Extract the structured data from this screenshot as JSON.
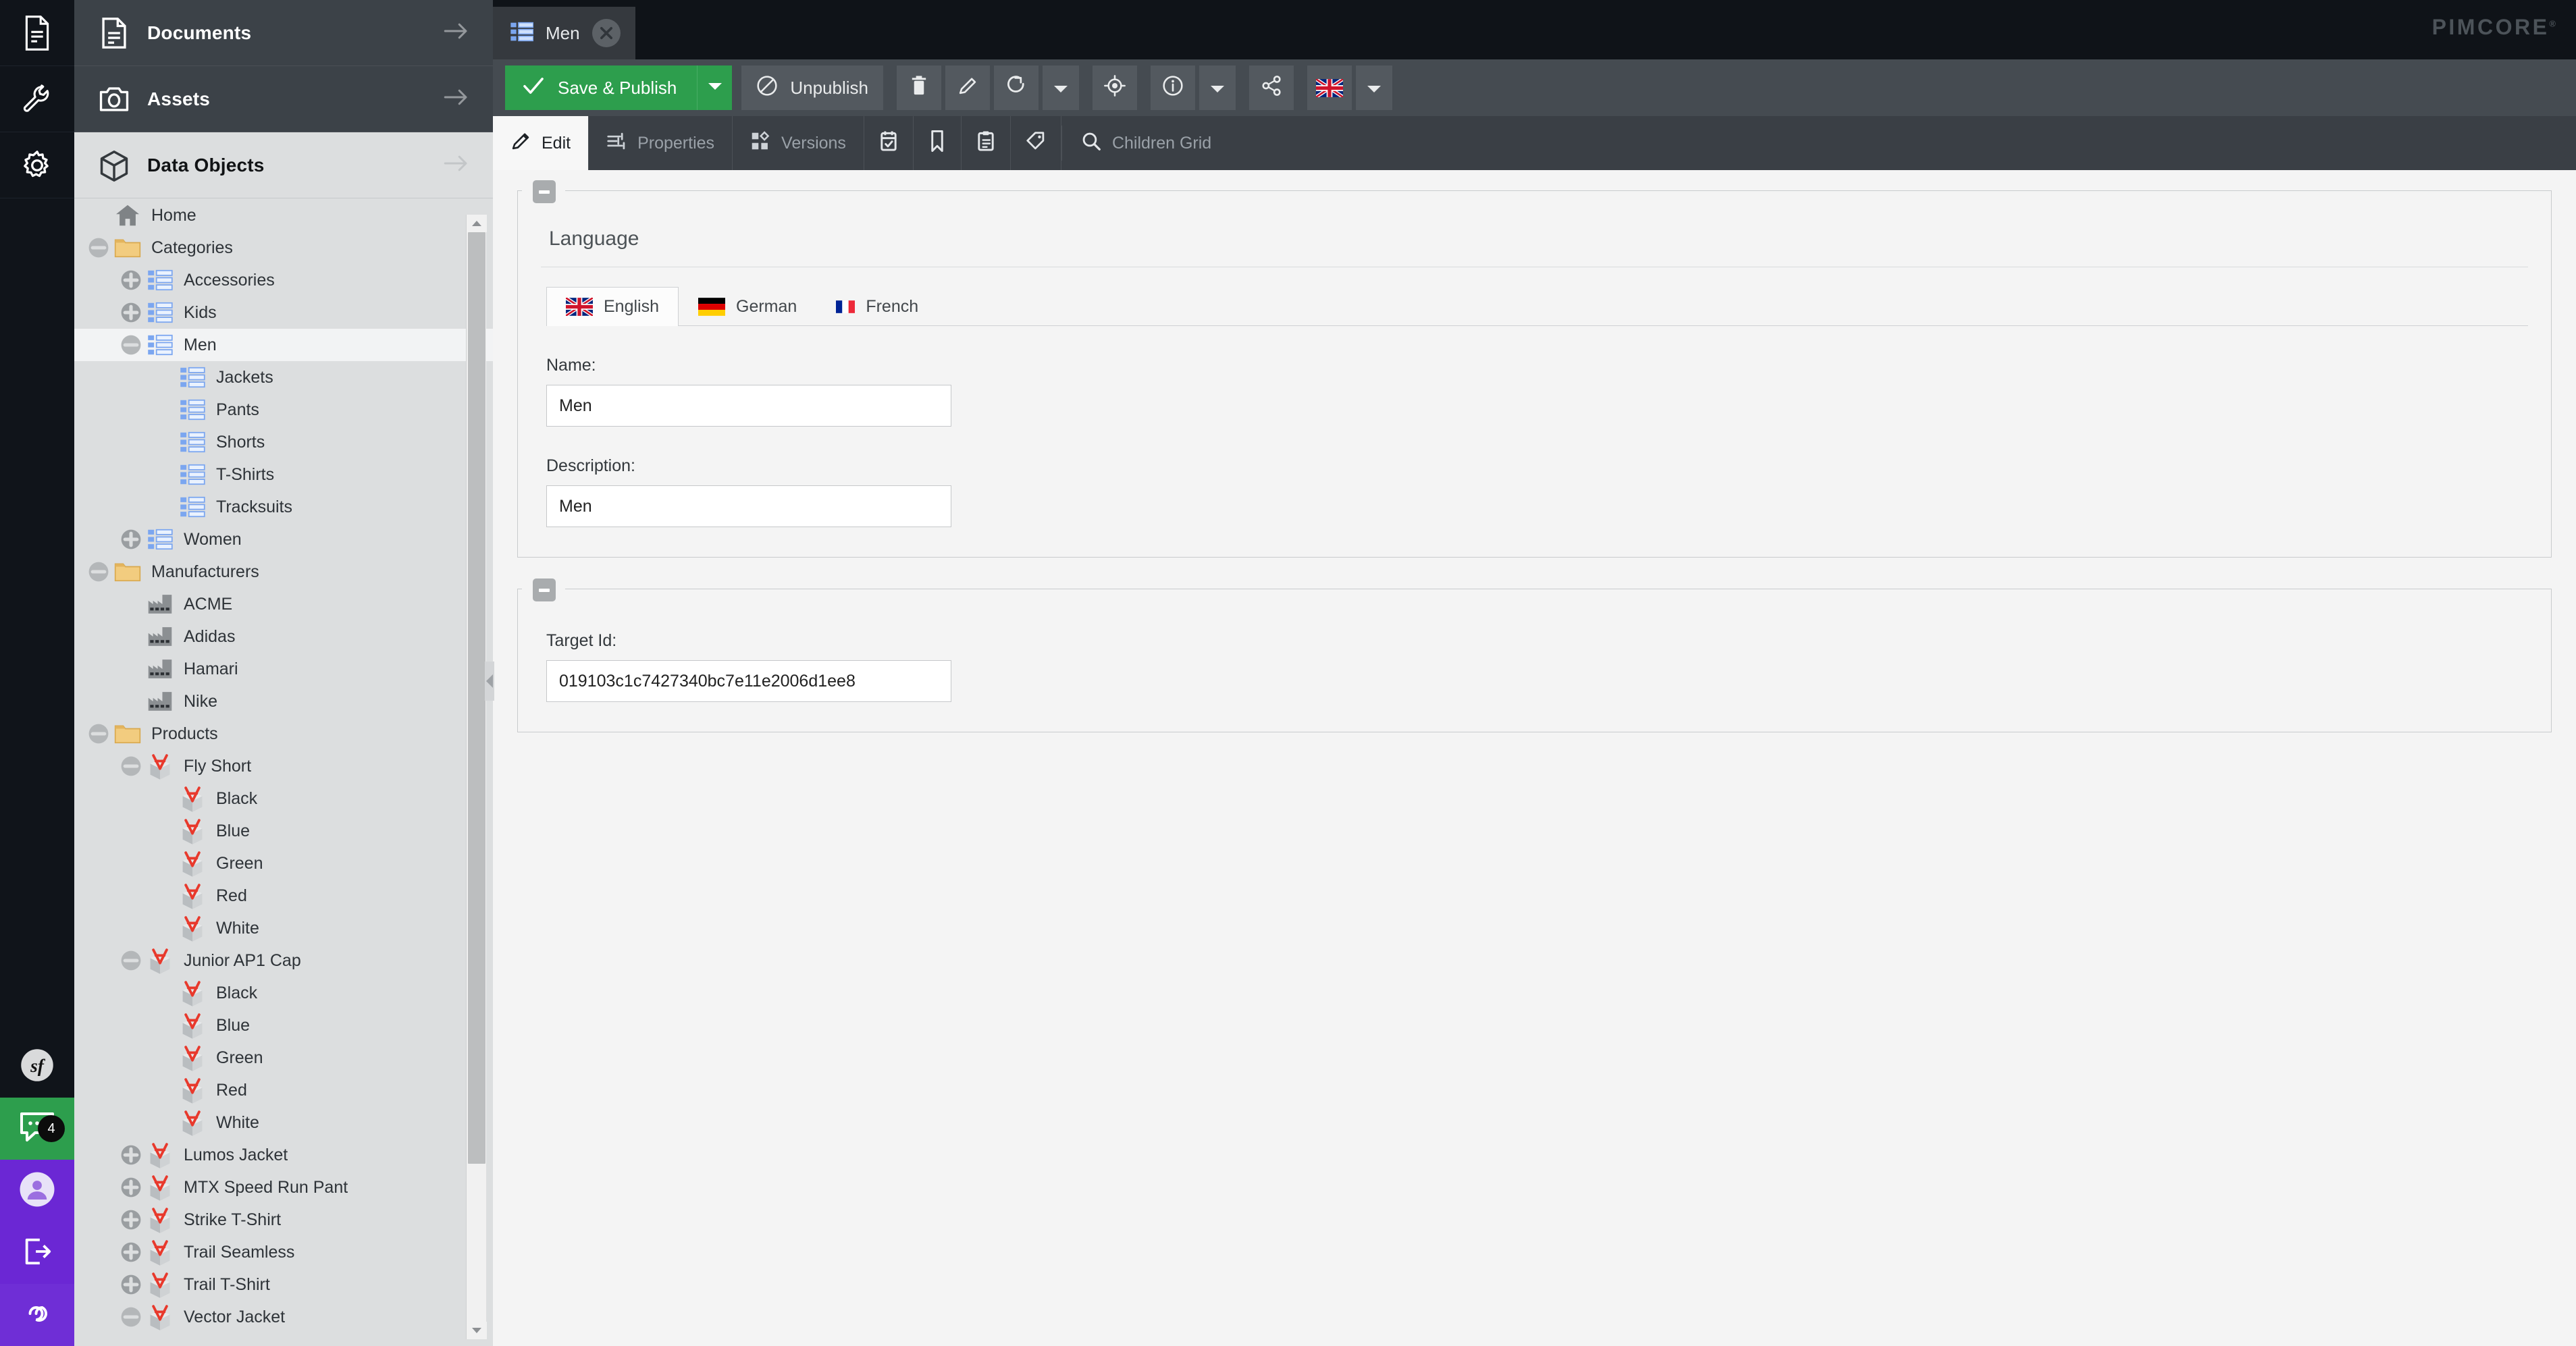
{
  "app": {
    "brand": "PIMCORE",
    "brand_sup": "®"
  },
  "rail": {
    "items": [
      {
        "name": "documents-rail-icon",
        "icon": "file-icon"
      },
      {
        "name": "tools-rail-icon",
        "icon": "wrench-icon"
      },
      {
        "name": "settings-rail-icon",
        "icon": "gear-icon"
      }
    ],
    "bottom": [
      {
        "name": "symfony-profiler",
        "icon": "symfony-icon",
        "label": ""
      },
      {
        "name": "notifications",
        "icon": "chat-icon",
        "badge": "4"
      },
      {
        "name": "user-profile",
        "icon": "user-avatar-icon"
      },
      {
        "name": "logout",
        "icon": "logout-icon"
      },
      {
        "name": "pimcore-infinity",
        "icon": "infinity-icon"
      }
    ]
  },
  "nav": {
    "sections": [
      {
        "label": "Documents",
        "icon": "document-icon",
        "active": false
      },
      {
        "label": "Assets",
        "icon": "camera-icon",
        "active": false
      },
      {
        "label": "Data Objects",
        "icon": "cube-icon",
        "active": true
      }
    ]
  },
  "tree": {
    "nodes": [
      {
        "label": "Home",
        "depth": 0,
        "toggle": "none",
        "icon": "home-icon",
        "selected": false
      },
      {
        "label": "Categories",
        "depth": 0,
        "toggle": "collapse",
        "icon": "folder-icon",
        "selected": false
      },
      {
        "label": "Accessories",
        "depth": 1,
        "toggle": "expand",
        "icon": "list-icon",
        "selected": false
      },
      {
        "label": "Kids",
        "depth": 1,
        "toggle": "expand",
        "icon": "list-icon",
        "selected": false
      },
      {
        "label": "Men",
        "depth": 1,
        "toggle": "collapse",
        "icon": "list-icon",
        "selected": true
      },
      {
        "label": "Jackets",
        "depth": 2,
        "toggle": "none",
        "icon": "list-icon",
        "selected": false
      },
      {
        "label": "Pants",
        "depth": 2,
        "toggle": "none",
        "icon": "list-icon",
        "selected": false
      },
      {
        "label": "Shorts",
        "depth": 2,
        "toggle": "none",
        "icon": "list-icon",
        "selected": false
      },
      {
        "label": "T-Shirts",
        "depth": 2,
        "toggle": "none",
        "icon": "list-icon",
        "selected": false
      },
      {
        "label": "Tracksuits",
        "depth": 2,
        "toggle": "none",
        "icon": "list-icon",
        "selected": false
      },
      {
        "label": "Women",
        "depth": 1,
        "toggle": "expand",
        "icon": "list-icon",
        "selected": false
      },
      {
        "label": "Manufacturers",
        "depth": 0,
        "toggle": "collapse",
        "icon": "folder-icon",
        "selected": false
      },
      {
        "label": "ACME",
        "depth": 1,
        "toggle": "none",
        "icon": "factory-icon",
        "selected": false
      },
      {
        "label": "Adidas",
        "depth": 1,
        "toggle": "none",
        "icon": "factory-icon",
        "selected": false
      },
      {
        "label": "Hamari",
        "depth": 1,
        "toggle": "none",
        "icon": "factory-icon",
        "selected": false
      },
      {
        "label": "Nike",
        "depth": 1,
        "toggle": "none",
        "icon": "factory-icon",
        "selected": false
      },
      {
        "label": "Products",
        "depth": 0,
        "toggle": "collapse",
        "icon": "folder-icon",
        "selected": false
      },
      {
        "label": "Fly Short",
        "depth": 1,
        "toggle": "collapse",
        "icon": "product-icon",
        "selected": false
      },
      {
        "label": "Black",
        "depth": 2,
        "toggle": "none",
        "icon": "product-icon",
        "selected": false
      },
      {
        "label": "Blue",
        "depth": 2,
        "toggle": "none",
        "icon": "product-icon",
        "selected": false
      },
      {
        "label": "Green",
        "depth": 2,
        "toggle": "none",
        "icon": "product-icon",
        "selected": false
      },
      {
        "label": "Red",
        "depth": 2,
        "toggle": "none",
        "icon": "product-icon",
        "selected": false
      },
      {
        "label": "White",
        "depth": 2,
        "toggle": "none",
        "icon": "product-icon",
        "selected": false
      },
      {
        "label": "Junior AP1 Cap",
        "depth": 1,
        "toggle": "collapse",
        "icon": "product-icon",
        "selected": false
      },
      {
        "label": "Black",
        "depth": 2,
        "toggle": "none",
        "icon": "product-icon",
        "selected": false
      },
      {
        "label": "Blue",
        "depth": 2,
        "toggle": "none",
        "icon": "product-icon",
        "selected": false
      },
      {
        "label": "Green",
        "depth": 2,
        "toggle": "none",
        "icon": "product-icon",
        "selected": false
      },
      {
        "label": "Red",
        "depth": 2,
        "toggle": "none",
        "icon": "product-icon",
        "selected": false
      },
      {
        "label": "White",
        "depth": 2,
        "toggle": "none",
        "icon": "product-icon",
        "selected": false
      },
      {
        "label": "Lumos Jacket",
        "depth": 1,
        "toggle": "expand",
        "icon": "product-icon",
        "selected": false
      },
      {
        "label": "MTX Speed Run Pant",
        "depth": 1,
        "toggle": "expand",
        "icon": "product-icon",
        "selected": false
      },
      {
        "label": "Strike T-Shirt",
        "depth": 1,
        "toggle": "expand",
        "icon": "product-icon",
        "selected": false
      },
      {
        "label": "Trail Seamless",
        "depth": 1,
        "toggle": "expand",
        "icon": "product-icon",
        "selected": false
      },
      {
        "label": "Trail T-Shirt",
        "depth": 1,
        "toggle": "expand",
        "icon": "product-icon",
        "selected": false
      },
      {
        "label": "Vector Jacket",
        "depth": 1,
        "toggle": "collapse",
        "icon": "product-icon",
        "selected": false
      }
    ]
  },
  "doc_tab": {
    "label": "Men",
    "icon": "list-icon",
    "close_icon": "close-icon"
  },
  "toolbar": {
    "save_publish_label": "Save & Publish",
    "save_publish_icon": "check-icon",
    "save_publish_menu_icon": "caret-down-icon",
    "unpublish_label": "Unpublish",
    "unpublish_icon": "no-entry-icon",
    "delete_icon": "trash-icon",
    "rename_icon": "pencil-icon",
    "reload_icon": "refresh-icon",
    "reload_menu_icon": "caret-down-icon",
    "locate_icon": "crosshair-icon",
    "info_icon": "info-icon",
    "info_menu_icon": "caret-down-icon",
    "share_icon": "share-icon",
    "language_icon": "flag-uk-icon",
    "language_menu_icon": "caret-down-icon"
  },
  "subtabs": {
    "items": [
      {
        "label": "Edit",
        "icon": "pencil-icon",
        "active": true
      },
      {
        "label": "Properties",
        "icon": "sliders-icon",
        "active": false
      },
      {
        "label": "Versions",
        "icon": "versions-icon",
        "active": false
      },
      {
        "label": "",
        "icon": "schedule-icon",
        "active": false
      },
      {
        "label": "",
        "icon": "bookmark-icon",
        "active": false
      },
      {
        "label": "",
        "icon": "notes-icon",
        "active": false
      },
      {
        "label": "",
        "icon": "tag-icon",
        "active": false
      }
    ],
    "search": {
      "label": "Children Grid",
      "icon": "search-icon"
    }
  },
  "editor": {
    "language_fieldset": {
      "legend": "Language",
      "collapse_icon": "minus-icon",
      "language_tabs": [
        {
          "label": "English",
          "flag": "flag-uk-icon",
          "active": true
        },
        {
          "label": "German",
          "flag": "flag-de-icon",
          "active": false
        },
        {
          "label": "French",
          "flag": "flag-fr-icon",
          "active": false
        }
      ],
      "fields": [
        {
          "label": "Name:",
          "value": "Men",
          "placeholder": ""
        },
        {
          "label": "Description:",
          "value": "Men",
          "placeholder": ""
        }
      ]
    },
    "target_fieldset": {
      "collapse_icon": "minus-icon",
      "fields": [
        {
          "label": "Target Id:",
          "value": "019103c1c7427340bc7e11e2006d1ee8",
          "placeholder": ""
        }
      ]
    }
  },
  "colors": {
    "accent_green": "#2d9e4d",
    "rail_dark": "#10141a",
    "toolbar_dark": "#454b51",
    "subtab_dark": "#3a3f45",
    "tree_bg": "#dcdedf",
    "purple": "#6b27d4"
  }
}
